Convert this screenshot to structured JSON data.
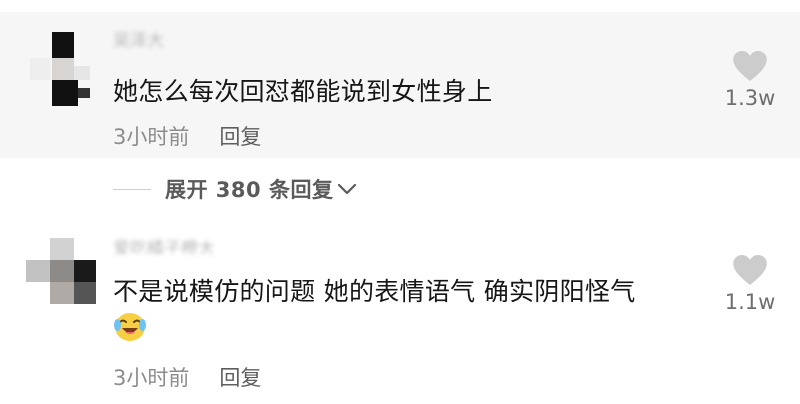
{
  "comments": [
    {
      "username": "吴泽大",
      "text": "她怎么每次回怼都能说到女性身上",
      "time": "3小时前",
      "reply_label": "回复",
      "likes": "1.3w"
    },
    {
      "username": "爱吃橘子橙大",
      "text": "不是说模仿的问题 她的表情语气 确实阴阳怪气",
      "emoji": "crying-laughing-emoji",
      "time": "3小时前",
      "reply_label": "回复",
      "likes": "1.1w"
    }
  ],
  "expand_replies": {
    "label": "展开 380 条回复"
  },
  "icons": {
    "like": "heart-icon",
    "expand": "chevron-down-icon"
  },
  "colors": {
    "highlight_background": "#f6f6f6",
    "heart": "#cccccc"
  }
}
